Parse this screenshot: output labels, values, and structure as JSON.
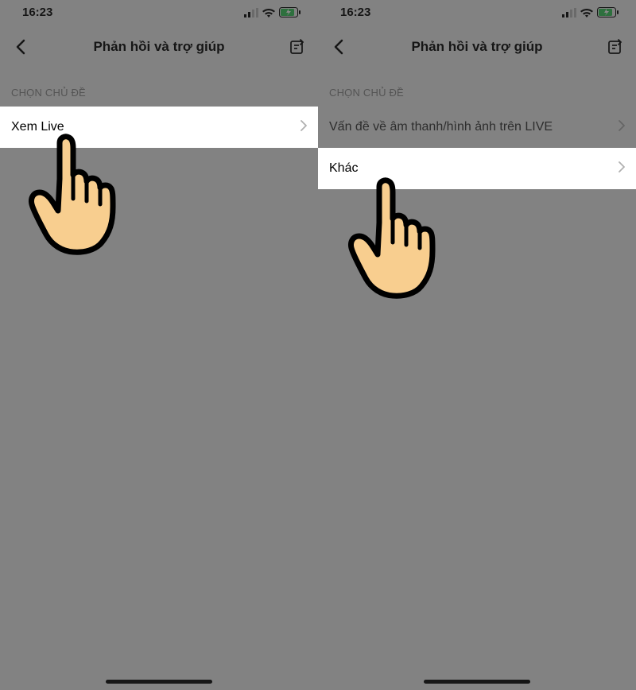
{
  "left": {
    "status": {
      "time": "16:23"
    },
    "header": {
      "title": "Phản hồi và trợ giúp"
    },
    "section_label": "CHỌN CHỦ ĐỀ",
    "items": [
      {
        "label": "Xem Live",
        "active": true
      }
    ]
  },
  "right": {
    "status": {
      "time": "16:23"
    },
    "header": {
      "title": "Phản hồi và trợ giúp"
    },
    "section_label": "CHỌN CHỦ ĐỀ",
    "items": [
      {
        "label": "Vấn đề về âm thanh/hình ảnh trên LIVE",
        "active": false
      },
      {
        "label": "Khác",
        "active": true
      }
    ]
  }
}
